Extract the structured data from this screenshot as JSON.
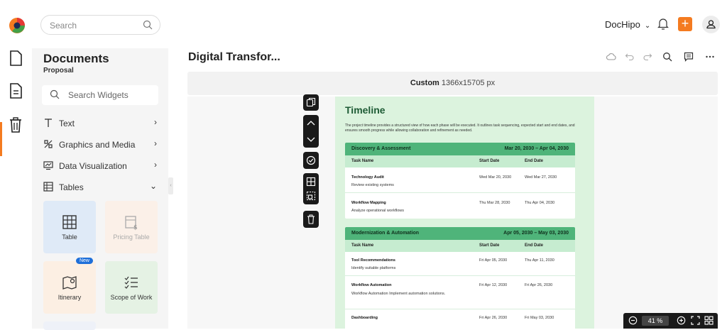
{
  "header": {
    "search_placeholder": "Search",
    "brand": "DocHipo",
    "accent_color": "#f47b20"
  },
  "panel": {
    "title": "Documents",
    "subtitle": "Proposal",
    "search_placeholder": "Search Widgets",
    "categories": [
      {
        "label": "Text",
        "icon": "text-icon",
        "arrow": ">"
      },
      {
        "label": "Graphics and Media",
        "icon": "graphics-icon",
        "arrow": ">"
      },
      {
        "label": "Data Visualization",
        "icon": "chart-icon",
        "arrow": ">"
      },
      {
        "label": "Tables",
        "icon": "table-icon",
        "arrow": "v"
      }
    ],
    "cards": [
      {
        "label": "Table",
        "icon": "table-icon"
      },
      {
        "label": "Pricing Table",
        "icon": "pricing-table-icon"
      },
      {
        "label": "Itinerary",
        "icon": "map-pin-icon",
        "badge": "New"
      },
      {
        "label": "Scope of Work",
        "icon": "checklist-icon"
      }
    ]
  },
  "editor": {
    "doc_title": "Digital Transfor...",
    "size_label": "Custom",
    "size_value": "1366x15705 px",
    "zoom": "41 %"
  },
  "document": {
    "heading": "Timeline",
    "intro": "The project timeline provides a structured view of how each phase will be executed. It outlines task sequencing, expected start and end dates, and ensures smooth progress while allowing collaboration and refinement as needed.",
    "phases": [
      {
        "name": "Discovery & Assessment",
        "range": "Mar 20, 2030 – Apr 04, 2030",
        "columns": [
          "Task Name",
          "Start Date",
          "End Date"
        ],
        "tasks": [
          {
            "name": "Technology Audit",
            "desc": "Review existing systems",
            "start": "Wed Mar 20, 2030",
            "end": "Wed Mar 27, 2030"
          },
          {
            "name": "Workflow Mapping",
            "desc": "Analyze operational workflows",
            "start": "Thu Mar 28, 2030",
            "end": "Thu Apr 04, 2030"
          }
        ]
      },
      {
        "name": "Modernization & Automation",
        "range": "Apr 05, 2030 – May 03, 2030",
        "columns": [
          "Task Name",
          "Start Date",
          "End Date"
        ],
        "tasks": [
          {
            "name": "Tool Recommendations",
            "desc": "Identify suitable platforms",
            "start": "Fri Apr 05, 2030",
            "end": "Thu Apr 11, 2030"
          },
          {
            "name": "Workflow Automation",
            "desc": "Workflow Automation Implement automation solutions.",
            "start": "Fri Apr 12, 2030",
            "end": "Fri Apr 26, 2030"
          },
          {
            "name": "Dashboarding",
            "desc": "",
            "start": "Fri Apr 26, 2030",
            "end": "Fri May 03, 2030"
          }
        ]
      }
    ]
  }
}
